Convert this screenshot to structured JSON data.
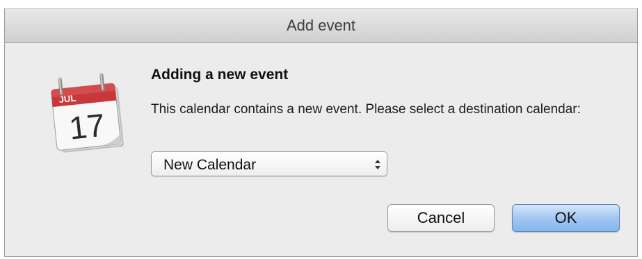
{
  "window": {
    "title": "Add event"
  },
  "dialog": {
    "icon": "calendar-app-icon",
    "icon_month": "JUL",
    "icon_day": "17",
    "heading": "Adding a new event",
    "message": "This calendar contains a new event. Please select a destination calendar:",
    "calendar_select": {
      "selected": "New Calendar"
    },
    "buttons": {
      "cancel_label": "Cancel",
      "ok_label": "OK"
    }
  },
  "colors": {
    "dialog_background": "#ececec",
    "default_button": "#9ec5f1",
    "calendar_red": "#c8383a"
  }
}
